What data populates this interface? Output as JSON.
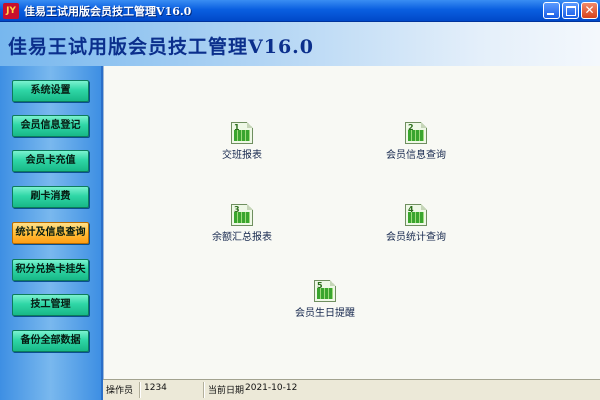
{
  "window": {
    "title": "佳易王试用版会员技工管理V16.0",
    "icon": "app-logo-icon"
  },
  "header": {
    "title": "佳易王试用版会员技工管理V16.0"
  },
  "sidebar": {
    "items": [
      {
        "label": "系统设置"
      },
      {
        "label": "会员信息登记"
      },
      {
        "label": "会员卡充值"
      },
      {
        "label": "刷卡消费"
      },
      {
        "label": "统计及信息查询",
        "active": true
      },
      {
        "label": "积分兑换卡挂失"
      },
      {
        "label": "技工管理"
      },
      {
        "label": "备份全部数据"
      }
    ]
  },
  "reports": [
    {
      "number": "1",
      "label": "交班报表"
    },
    {
      "number": "2",
      "label": "会员信息查询"
    },
    {
      "number": "3",
      "label": "余额汇总报表"
    },
    {
      "number": "4",
      "label": "会员统计查询"
    },
    {
      "number": "5",
      "label": "会员生日提醒"
    }
  ],
  "statusbar": {
    "operator_label": "操作员",
    "operator_value": "1234",
    "date_label": "当前日期",
    "date_value": "2021-10-12"
  },
  "colors": {
    "titlebar": "#0a5fe0",
    "nav_button": "#2fd6a6",
    "nav_button_active": "#ffbf3a",
    "header_title": "#0b2f8c"
  }
}
